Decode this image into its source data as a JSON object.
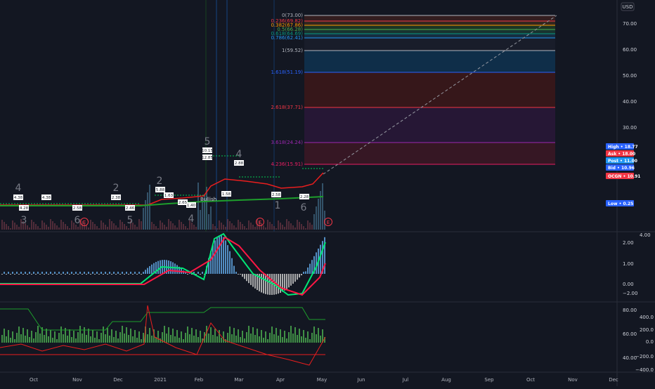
{
  "currency_label": "USD",
  "colors": {
    "background": "#131722",
    "pane_divider": "#2a2e39",
    "price_line": "#e91e1e",
    "ema_line": "#1e9e2c",
    "macd": "#00e676",
    "signal": "#ff1744",
    "hist_pos": "#5b9bd5",
    "hist_neg": "#bdbdbd"
  },
  "price_axis_ticks": [
    "70.00",
    "60.00",
    "50.00",
    "40.00",
    "30.00"
  ],
  "macd_axis_ticks": [
    "4.00",
    "2.00",
    "1.00",
    "0.00",
    "−2.00"
  ],
  "osc_left_ticks": [
    "80.00",
    "60.00",
    "40.00"
  ],
  "osc_right_ticks": [
    "400.0",
    "200.0",
    "0.0",
    "−200.0",
    "−400.0"
  ],
  "time_axis_labels": [
    "Oct",
    "Nov",
    "Dec",
    "2021",
    "Feb",
    "Mar",
    "Apr",
    "May",
    "Jun",
    "Jul",
    "Aug",
    "Sep",
    "Oct",
    "Nov",
    "Dec"
  ],
  "price_badges": [
    {
      "label": "High",
      "value": "18.77",
      "color": "#2962ff"
    },
    {
      "label": "Ask",
      "value": "18.00",
      "color": "#f23645"
    },
    {
      "label": "Post",
      "value": "11.00",
      "color": "#2196f3"
    },
    {
      "label": "Bid",
      "value": "10.96",
      "color": "#2962ff"
    },
    {
      "label": "OCGN",
      "value": "10.91",
      "color": "#f23645"
    },
    {
      "label": "Low",
      "value": "0.25",
      "color": "#2962ff"
    }
  ],
  "fib_levels": [
    {
      "text": "0(73.00)",
      "color": "#b2b5be"
    },
    {
      "text": "0.236(69.82)",
      "color": "#f23645"
    },
    {
      "text": "0.382(67.86)",
      "color": "#ff9800"
    },
    {
      "text": "0.5(66.28)",
      "color": "#4caf50"
    },
    {
      "text": "0.618(64.69)",
      "color": "#089981"
    },
    {
      "text": "0.786(62.41)",
      "color": "#2196f3"
    },
    {
      "text": "1(59.52)",
      "color": "#b2b5be"
    },
    {
      "text": "1.618(51.19)",
      "color": "#2962ff"
    },
    {
      "text": "2.618(37.71)",
      "color": "#f23645"
    },
    {
      "text": "3.618(24.24)",
      "color": "#9c27b0"
    },
    {
      "text": "4.236(15.91)",
      "color": "#e91e63"
    }
  ],
  "annotations": {
    "bullish": "Bullish",
    "small_numbers": [
      "4",
      "3",
      "6",
      "2",
      "5",
      "2",
      "4",
      "5",
      "4",
      "1",
      "6"
    ],
    "earnings_marker": "E",
    "callout_values": [
      "4.38",
      "4.28",
      "4.38",
      "2.58",
      "2.38",
      "2.46",
      "5.88",
      "1.40",
      "10.15",
      "1.58",
      "2.88",
      "2.58",
      "2.28",
      "12.85",
      "1.63",
      "2.65"
    ]
  },
  "chart_data": {
    "type": "line",
    "series": [],
    "y_unit": "USD"
  }
}
